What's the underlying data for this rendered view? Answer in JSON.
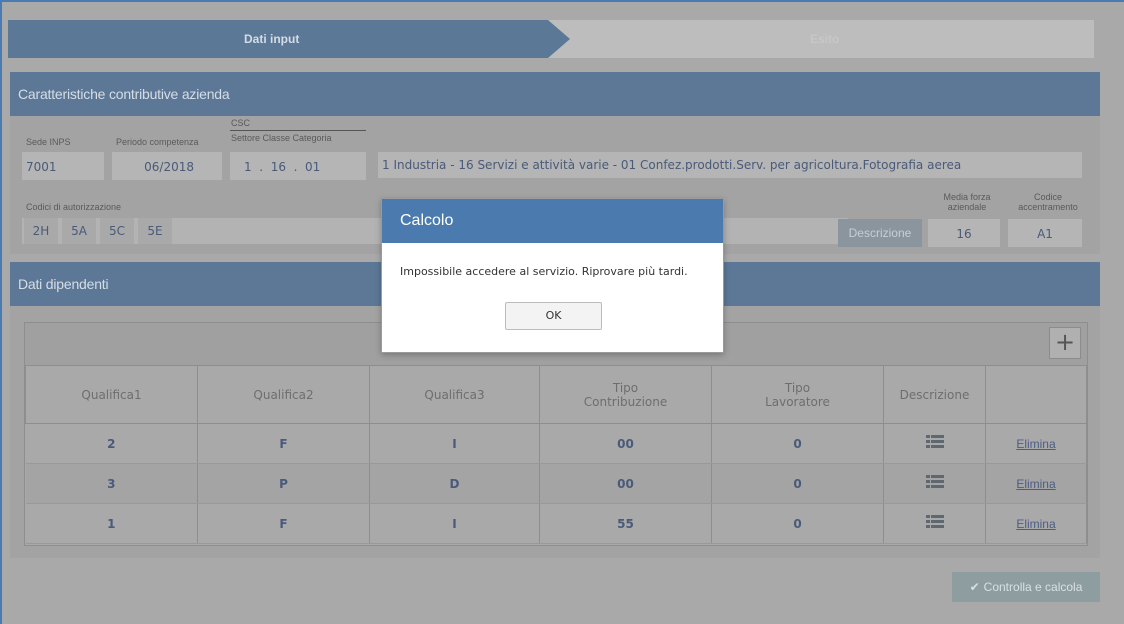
{
  "steps": {
    "step1": "Dati input",
    "step2": "Esito"
  },
  "azienda": {
    "header": "Caratteristiche contributive azienda",
    "sede_label": "Sede INPS",
    "sede_value": "7001",
    "periodo_label": "Periodo competenza",
    "periodo_value": "06/2018",
    "csc_label": "CSC",
    "csc_sub_label": "Settore Classe Categoria",
    "csc_value": "1  .  16  .  01",
    "csc_description": "1 Industria - 16 Servizi e attività varie - 01 Confez.prodotti.Serv. per agricoltura.Fotografia aerea",
    "codici_label": "Codici di autorizzazione",
    "codici": [
      "2H",
      "5A",
      "5C",
      "5E"
    ],
    "descrizione_button": "Descrizione",
    "media_label": "Media forza aziendale",
    "media_value": "16",
    "codice_acc_label": "Codice accentramento",
    "codice_acc_value": "A1"
  },
  "dipendenti": {
    "header": "Dati dipendenti",
    "add_icon": "plus-icon",
    "columns": [
      "Qualifica1",
      "Qualifica2",
      "Qualifica3",
      "Tipo Contribuzione",
      "Tipo Lavoratore",
      "Descrizione",
      ""
    ],
    "rows": [
      {
        "q1": "2",
        "q2": "F",
        "q3": "I",
        "tipo_contr": "00",
        "tipo_lav": "0",
        "action": "Elimina"
      },
      {
        "q1": "3",
        "q2": "P",
        "q3": "D",
        "tipo_contr": "00",
        "tipo_lav": "0",
        "action": "Elimina"
      },
      {
        "q1": "1",
        "q2": "F",
        "q3": "I",
        "tipo_contr": "55",
        "tipo_lav": "0",
        "action": "Elimina"
      }
    ]
  },
  "calc_button": "Controlla e calcola",
  "modal": {
    "title": "Calcolo",
    "message": "Impossibile accedere al servizio. Riprovare più tardi.",
    "ok": "OK"
  },
  "colors": {
    "accent": "#4a7aae",
    "header": "#5c7896"
  }
}
